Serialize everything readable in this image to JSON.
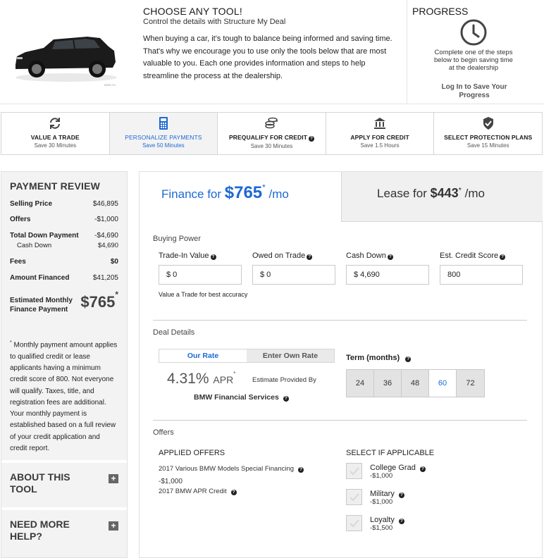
{
  "header": {
    "title": "CHOOSE ANY TOOL!",
    "subtitle": "Control the details with Structure My Deal",
    "body": "When buying a car, it's tough to balance being informed and saving time. That's why we encourage you to use only the tools below that are most valuable to you. Each one provides information and steps to help streamline the process at the dealership.",
    "car_caption": "BMW X3"
  },
  "progress": {
    "title": "PROGRESS",
    "text": "Complete one of the steps below to begin saving time at the dealership",
    "login": "Log In to Save Your Progress"
  },
  "tabs": [
    {
      "label": "VALUE A TRADE",
      "sub": "Save 30 Minutes",
      "icon": "refresh-icon"
    },
    {
      "label": "PERSONALIZE PAYMENTS",
      "sub": "Save 50 Minutes",
      "icon": "calculator-icon"
    },
    {
      "label": "PREQUALIFY FOR CREDIT",
      "sub": "Save 30 Minutes",
      "icon": "coins-icon"
    },
    {
      "label": "APPLY FOR CREDIT",
      "sub": "Save 1.5 Hours",
      "icon": "bank-icon"
    },
    {
      "label": "SELECT PROTECTION PLANS",
      "sub": "Save 15 Minutes",
      "icon": "shield-icon"
    }
  ],
  "review": {
    "title": "PAYMENT REVIEW",
    "selling_price_label": "Selling Price",
    "selling_price": "$46,895",
    "offers_label": "Offers",
    "offers": "-$1,000",
    "total_down_label": "Total Down Payment",
    "total_down": "-$4,690",
    "cash_down_label": "Cash Down",
    "cash_down": "$4,690",
    "fees_label": "Fees",
    "fees": "$0",
    "amount_financed_label": "Amount Financed",
    "amount_financed": "$41,205",
    "est_label": "Estimated Monthly Finance Payment",
    "est_value": "$765",
    "asterisk": "*",
    "disclaimer": " Monthly payment amount applies to qualified credit or lease applicants having a minimum credit score of 800.  Not everyone will qualify. Taxes, title, and registration fees are additional. Your monthly payment is established based on a full review of your credit application and credit report."
  },
  "sections": {
    "about": "ABOUT THIS TOOL",
    "help": "NEED MORE HELP?",
    "plus": "+"
  },
  "finance": {
    "prefix": "Finance for ",
    "amount": "$765",
    "asterisk": "*",
    "suffix": " /mo"
  },
  "lease": {
    "prefix": "Lease for ",
    "amount": "$443",
    "asterisk": "*",
    "suffix": " /mo"
  },
  "buying_power": {
    "title": "Buying Power",
    "trade_in_label": "Trade-In Value",
    "trade_in": "$ 0",
    "owed_label": "Owed on Trade",
    "owed": "$ 0",
    "cash_down_label": "Cash Down",
    "cash_down": "$ 4,690",
    "credit_label": "Est. Credit Score",
    "credit": "800",
    "note": "Value a Trade for best accuracy"
  },
  "deal": {
    "title": "Deal Details",
    "our_rate": "Our Rate",
    "own_rate": "Enter Own Rate",
    "apr_value": "4.31%",
    "apr_unit": "APR",
    "asterisk": "*",
    "estimate_by": "Estimate Provided By",
    "provider": "BMW Financial Services",
    "term_label": "Term (months)",
    "terms": [
      "24",
      "36",
      "48",
      "60",
      "72"
    ],
    "selected_term": "60"
  },
  "offers": {
    "title": "Offers",
    "applied_title": "APPLIED OFFERS",
    "applied_name": "2017 Various BMW Models Special Financing",
    "applied_amount": "-$1,000",
    "applied_name2": "2017 BMW APR Credit",
    "select_title": "SELECT IF APPLICABLE",
    "options": [
      {
        "name": "College Grad",
        "amount": "-$1,000"
      },
      {
        "name": "Military",
        "amount": "-$1,000"
      },
      {
        "name": "Loyalty",
        "amount": "-$1,500"
      }
    ]
  },
  "colors": {
    "accent": "#1c69d4",
    "panel": "#f3f3f3"
  }
}
